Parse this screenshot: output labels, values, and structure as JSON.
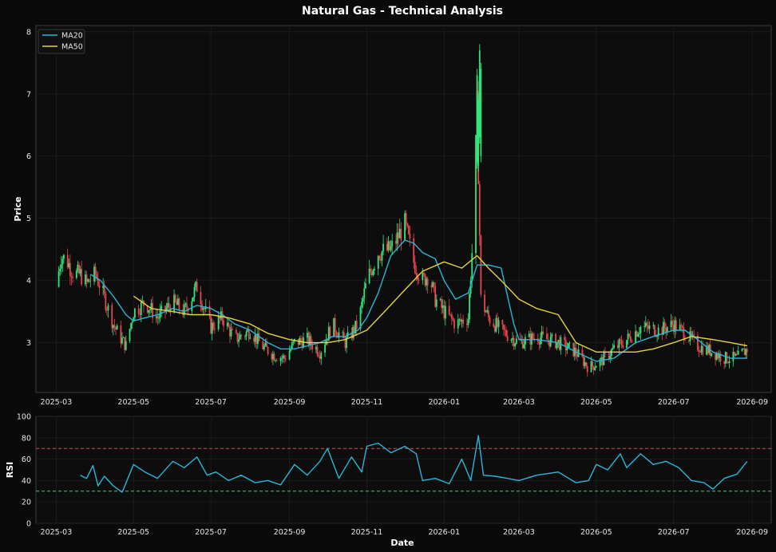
{
  "chart_data": [
    {
      "type": "line",
      "subtype": "candlestick",
      "title": "Natural Gas - Technical Analysis",
      "xlabel": "",
      "ylabel": "Price",
      "ylim": [
        2.2,
        8.1
      ],
      "yticks": [
        3,
        4,
        5,
        6,
        7,
        8
      ],
      "xlim": [
        "2025-02-13",
        "2026-09-16"
      ],
      "xticks": [
        "2025-03",
        "2025-05",
        "2025-07",
        "2025-09",
        "2025-11",
        "2026-01",
        "2026-03",
        "2026-05",
        "2026-07",
        "2026-09"
      ],
      "grid": true,
      "legend": "top-left",
      "up_color": "#2ee67a",
      "down_color": "#e8454f",
      "price_path": {
        "x": [
          "2025-03-01",
          "2025-03-05",
          "2025-03-10",
          "2025-03-15",
          "2025-03-20",
          "2025-03-25",
          "2025-04-01",
          "2025-04-05",
          "2025-04-10",
          "2025-04-15",
          "2025-04-20",
          "2025-04-25",
          "2025-05-01",
          "2025-05-10",
          "2025-05-20",
          "2025-06-01",
          "2025-06-10",
          "2025-06-20",
          "2025-06-25",
          "2025-07-01",
          "2025-07-10",
          "2025-07-20",
          "2025-08-01",
          "2025-08-10",
          "2025-08-20",
          "2025-08-28",
          "2025-09-05",
          "2025-09-15",
          "2025-09-25",
          "2025-10-05",
          "2025-10-15",
          "2025-10-25",
          "2025-11-01",
          "2025-11-10",
          "2025-11-20",
          "2025-12-01",
          "2025-12-08",
          "2025-12-15",
          "2025-12-20",
          "2025-12-25",
          "2026-01-01",
          "2026-01-10",
          "2026-01-20",
          "2026-01-24",
          "2026-01-27",
          "2026-01-30",
          "2026-02-05",
          "2026-02-15",
          "2026-03-01",
          "2026-03-15",
          "2026-04-01",
          "2026-04-15",
          "2026-04-25",
          "2026-05-05",
          "2026-05-15",
          "2026-05-25",
          "2026-06-05",
          "2026-06-20",
          "2026-07-01",
          "2026-07-10",
          "2026-07-20",
          "2026-08-01",
          "2026-08-10",
          "2026-08-20",
          "2026-08-28"
        ],
        "y": [
          3.9,
          4.4,
          4.3,
          4.1,
          4.1,
          3.95,
          4.1,
          3.9,
          3.6,
          3.3,
          3.1,
          2.95,
          3.5,
          3.65,
          3.4,
          3.65,
          3.5,
          3.9,
          3.6,
          3.25,
          3.4,
          3.05,
          3.2,
          2.95,
          2.8,
          2.75,
          3.0,
          3.05,
          2.85,
          3.3,
          3.0,
          3.3,
          4.0,
          4.45,
          4.5,
          4.9,
          4.3,
          4.0,
          4.1,
          3.7,
          3.5,
          3.3,
          3.4,
          4.8,
          6.8,
          3.7,
          3.4,
          3.2,
          3.0,
          3.1,
          3.0,
          2.85,
          2.6,
          2.7,
          2.9,
          3.05,
          3.25,
          3.2,
          3.3,
          3.15,
          2.95,
          2.85,
          2.75,
          2.75,
          2.9
        ]
      },
      "series": [
        {
          "name": "MA20",
          "color": "#29b6d8",
          "x": [
            "2025-03-28",
            "2025-04-05",
            "2025-04-15",
            "2025-04-25",
            "2025-05-01",
            "2025-05-10",
            "2025-05-20",
            "2025-06-01",
            "2025-06-10",
            "2025-06-20",
            "2025-07-01",
            "2025-07-10",
            "2025-07-20",
            "2025-08-01",
            "2025-08-15",
            "2025-08-25",
            "2025-09-05",
            "2025-09-15",
            "2025-09-25",
            "2025-10-05",
            "2025-10-15",
            "2025-10-25",
            "2025-11-01",
            "2025-11-10",
            "2025-11-20",
            "2025-12-01",
            "2025-12-08",
            "2025-12-15",
            "2025-12-25",
            "2026-01-01",
            "2026-01-10",
            "2026-01-20",
            "2026-01-27",
            "2026-02-05",
            "2026-02-15",
            "2026-02-25",
            "2026-03-01",
            "2026-03-15",
            "2026-04-01",
            "2026-04-15",
            "2026-05-01",
            "2026-05-15",
            "2026-06-01",
            "2026-06-15",
            "2026-07-01",
            "2026-07-10",
            "2026-07-20",
            "2026-08-01",
            "2026-08-15",
            "2026-08-28"
          ],
          "values": [
            4.1,
            4.0,
            3.75,
            3.45,
            3.35,
            3.4,
            3.45,
            3.55,
            3.5,
            3.6,
            3.55,
            3.45,
            3.3,
            3.2,
            3.0,
            2.9,
            2.9,
            2.95,
            3.0,
            3.1,
            3.1,
            3.2,
            3.4,
            3.8,
            4.4,
            4.65,
            4.6,
            4.45,
            4.35,
            4.0,
            3.7,
            3.8,
            4.25,
            4.25,
            4.2,
            3.3,
            3.05,
            3.05,
            3.0,
            2.85,
            2.7,
            2.75,
            3.0,
            3.1,
            3.2,
            3.2,
            3.05,
            2.85,
            2.75,
            2.75
          ]
        },
        {
          "name": "MA50",
          "color": "#e6d23c",
          "x": [
            "2025-05-01",
            "2025-05-15",
            "2025-06-01",
            "2025-06-15",
            "2025-07-01",
            "2025-07-15",
            "2025-08-01",
            "2025-08-15",
            "2025-09-01",
            "2025-09-15",
            "2025-10-01",
            "2025-10-15",
            "2025-11-01",
            "2025-11-15",
            "2025-12-01",
            "2025-12-15",
            "2026-01-01",
            "2026-01-15",
            "2026-01-27",
            "2026-02-05",
            "2026-02-15",
            "2026-03-01",
            "2026-03-15",
            "2026-04-01",
            "2026-04-15",
            "2026-05-01",
            "2026-05-15",
            "2026-06-01",
            "2026-06-15",
            "2026-07-01",
            "2026-07-15",
            "2026-08-01",
            "2026-08-15",
            "2026-08-28"
          ],
          "values": [
            3.75,
            3.55,
            3.5,
            3.45,
            3.45,
            3.4,
            3.3,
            3.15,
            3.05,
            3.0,
            3.0,
            3.05,
            3.2,
            3.5,
            3.85,
            4.15,
            4.3,
            4.2,
            4.4,
            4.2,
            4.0,
            3.7,
            3.55,
            3.45,
            3.0,
            2.85,
            2.85,
            2.85,
            2.9,
            3.0,
            3.1,
            3.05,
            3.0,
            2.95
          ]
        }
      ]
    },
    {
      "type": "line",
      "title": "",
      "xlabel": "Date",
      "ylabel": "RSI",
      "ylim": [
        0,
        100
      ],
      "yticks": [
        0,
        20,
        40,
        60,
        80,
        100
      ],
      "xticks": [
        "2025-03",
        "2025-05",
        "2025-07",
        "2025-09",
        "2025-11",
        "2026-01",
        "2026-03",
        "2026-05",
        "2026-07",
        "2026-09"
      ],
      "grid": true,
      "overbought": 70,
      "oversold": 30,
      "overbought_color": "#e04848",
      "oversold_color": "#2ed67a",
      "series": [
        {
          "color": "#29b6d8",
          "x": [
            "2025-03-20",
            "2025-03-25",
            "2025-03-30",
            "2025-04-03",
            "2025-04-08",
            "2025-04-15",
            "2025-04-22",
            "2025-05-01",
            "2025-05-10",
            "2025-05-20",
            "2025-06-01",
            "2025-06-10",
            "2025-06-20",
            "2025-06-28",
            "2025-07-05",
            "2025-07-15",
            "2025-07-25",
            "2025-08-05",
            "2025-08-15",
            "2025-08-25",
            "2025-09-05",
            "2025-09-15",
            "2025-09-25",
            "2025-10-01",
            "2025-10-10",
            "2025-10-20",
            "2025-10-28",
            "2025-11-01",
            "2025-11-10",
            "2025-11-20",
            "2025-12-01",
            "2025-12-10",
            "2025-12-15",
            "2025-12-25",
            "2026-01-05",
            "2026-01-15",
            "2026-01-22",
            "2026-01-28",
            "2026-02-01",
            "2026-02-10",
            "2026-02-20",
            "2026-03-01",
            "2026-03-15",
            "2026-04-01",
            "2026-04-15",
            "2026-04-25",
            "2026-05-01",
            "2026-05-10",
            "2026-05-20",
            "2026-05-25",
            "2026-06-05",
            "2026-06-15",
            "2026-06-25",
            "2026-07-05",
            "2026-07-15",
            "2026-07-25",
            "2026-08-01",
            "2026-08-10",
            "2026-08-20",
            "2026-08-28"
          ],
          "values": [
            45,
            42,
            54,
            35,
            44,
            35,
            29,
            55,
            48,
            42,
            58,
            52,
            62,
            45,
            48,
            40,
            45,
            38,
            40,
            36,
            55,
            45,
            58,
            70,
            42,
            62,
            48,
            72,
            75,
            66,
            72,
            65,
            40,
            42,
            37,
            60,
            40,
            82,
            45,
            44,
            42,
            40,
            45,
            48,
            38,
            40,
            55,
            50,
            65,
            52,
            65,
            55,
            58,
            52,
            40,
            38,
            32,
            42,
            46,
            58
          ]
        }
      ]
    }
  ]
}
